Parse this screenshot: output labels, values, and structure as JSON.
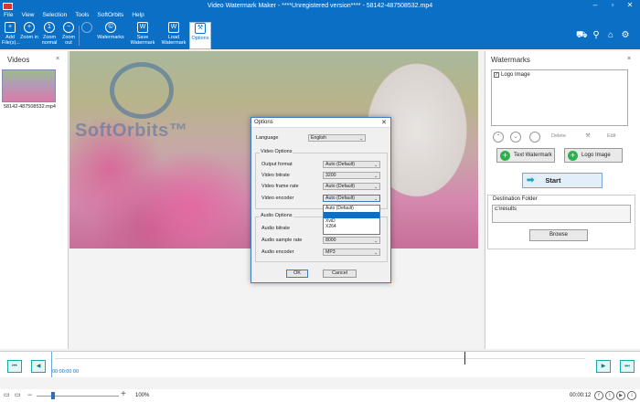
{
  "window": {
    "title": "Video Watermark Maker - ****Unregistered version**** - 58142-487508532.mp4",
    "controls": [
      "–",
      "▫",
      "✕"
    ]
  },
  "menu": [
    "File",
    "View",
    "Selection",
    "Tools",
    "SoftOrbits",
    "Help"
  ],
  "toolbar": {
    "add_files": "Add File(s)...",
    "zoom_in": "Zoom in",
    "zoom_normal": "Zoom normal",
    "zoom_out": "Zoom out",
    "watermarks": "Watermarks",
    "save_watermark": "Save Watermark",
    "load_watermark": "Load Watermark",
    "options": "Options"
  },
  "videos_panel": {
    "title": "Videos",
    "close": "×",
    "items": [
      {
        "name": "58142-487508532.mp4"
      }
    ]
  },
  "preview": {
    "watermark_text": "SoftOrbits™"
  },
  "watermarks_panel": {
    "title": "Watermarks",
    "close": "×",
    "items": [
      {
        "label": "Logo Image",
        "checked": true
      }
    ],
    "delete_label": "Delete",
    "edit_label": "Edit",
    "text_watermark": "Text Watermark",
    "logo_image": "Logo Image",
    "start": "Start",
    "destination_label": "Destination Folder",
    "destination_path": "c:\\results",
    "browse": "Browse"
  },
  "options_dialog": {
    "title": "Options",
    "close": "✕",
    "language_label": "Language",
    "language_value": "English",
    "video_group": "Video Options",
    "output_format_label": "Output format",
    "output_format_value": "Auto (Default)",
    "video_bitrate_label": "Video bitrate",
    "video_bitrate_value": "3200",
    "video_frame_rate_label": "Video frame rate",
    "video_frame_rate_value": "Auto (Default)",
    "video_encoder_label": "Video encoder",
    "video_encoder_value": "Auto (Default)",
    "video_encoder_options": [
      "Auto (Default)",
      "",
      "XviD",
      "X264"
    ],
    "video_encoder_highlighted": 1,
    "audio_group": "Audio Options",
    "audio_bitrate_label": "Audio bitrate",
    "audio_bitrate_value": "64",
    "audio_sample_rate_label": "Audio sample rate",
    "audio_sample_rate_value": "8000",
    "audio_encoder_label": "Audio encoder",
    "audio_encoder_value": "MP3",
    "ok": "OK",
    "cancel": "Cancel"
  },
  "timeline": {
    "start_time": "00:00:00 00",
    "zoom": "100%",
    "end_time": "00:00:12"
  },
  "colors": {
    "ribbon_blue": "#0b6fc6",
    "start_arrow": "#1fa7b4",
    "add_green": "#2bb24c"
  }
}
